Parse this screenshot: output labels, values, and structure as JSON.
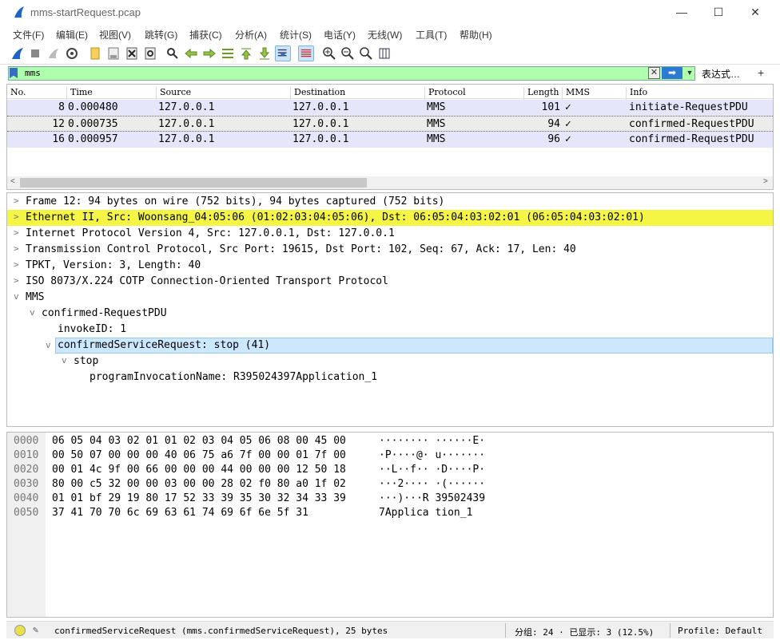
{
  "window": {
    "title": "mms-startRequest.pcap",
    "minimize": "—",
    "maximize": "☐",
    "close": "✕"
  },
  "menu": [
    "文件(F)",
    "编辑(E)",
    "视图(V)",
    "跳转(G)",
    "捕获(C)",
    "分析(A)",
    "统计(S)",
    "电话(Y)",
    "无线(W)",
    "工具(T)",
    "帮助(H)"
  ],
  "toolbar": {
    "icons": [
      "shark-fin-start-icon",
      "stop-capture-icon",
      "restart-capture-icon",
      "capture-options-icon",
      "open-file-icon",
      "save-file-icon",
      "close-file-icon",
      "reload-file-icon",
      "find-packet-icon",
      "go-back-icon",
      "go-forward-icon",
      "go-to-packet-icon",
      "first-packet-icon",
      "last-packet-icon",
      "autoscroll-icon",
      "colorize-icon",
      "zoom-in-icon",
      "zoom-out-icon",
      "normal-size-icon",
      "resize-columns-icon"
    ]
  },
  "filter": {
    "value": "mms",
    "clear": "✕",
    "apply": "➡",
    "dropdown": "▼",
    "expression": "表达式…",
    "add": "+"
  },
  "packet_list": {
    "columns": [
      "No.",
      "Time",
      "Source",
      "Destination",
      "Protocol",
      "Length",
      "MMS",
      "Info"
    ],
    "rows": [
      {
        "no": "8",
        "time": "0.000480",
        "src": "127.0.0.1",
        "dst": "127.0.0.1",
        "proto": "MMS",
        "len": "101",
        "mms": "✓",
        "info": "initiate-RequestPDU"
      },
      {
        "no": "12",
        "time": "0.000735",
        "src": "127.0.0.1",
        "dst": "127.0.0.1",
        "proto": "MMS",
        "len": "94",
        "mms": "✓",
        "info": "confirmed-RequestPDU"
      },
      {
        "no": "16",
        "time": "0.000957",
        "src": "127.0.0.1",
        "dst": "127.0.0.1",
        "proto": "MMS",
        "len": "96",
        "mms": "✓",
        "info": "confirmed-RequestPDU"
      }
    ]
  },
  "details": [
    {
      "twisty": ">",
      "text": "Frame 12: 94 bytes on wire (752 bits), 94 bytes captured (752 bits)"
    },
    {
      "twisty": ">",
      "text": "Ethernet II, Src: Woonsang_04:05:06 (01:02:03:04:05:06), Dst: 06:05:04:03:02:01 (06:05:04:03:02:01)"
    },
    {
      "twisty": ">",
      "text": "Internet Protocol Version 4, Src: 127.0.0.1, Dst: 127.0.0.1"
    },
    {
      "twisty": ">",
      "text": "Transmission Control Protocol, Src Port: 19615, Dst Port: 102, Seq: 67, Ack: 17, Len: 40"
    },
    {
      "twisty": ">",
      "text": "TPKT, Version: 3, Length: 40"
    },
    {
      "twisty": ">",
      "text": "ISO 8073/X.224 COTP Connection-Oriented Transport Protocol"
    },
    {
      "twisty": "v",
      "text": "MMS"
    },
    {
      "twisty": "v",
      "text": "confirmed-RequestPDU"
    },
    {
      "twisty": "",
      "text": "invokeID: 1"
    },
    {
      "twisty": "v",
      "text": "confirmedServiceRequest: stop (41)"
    },
    {
      "twisty": "v",
      "text": "stop"
    },
    {
      "twisty": "",
      "text": "programInvocationName: R395024397Application_1"
    }
  ],
  "bytes": [
    {
      "off": "0000",
      "hex": "06 05 04 03 02 01 01 02  03 04 05 06 08 00 45 00",
      "ascii": "········ ······E·"
    },
    {
      "off": "0010",
      "hex": "00 50 07 00 00 00 40 06  75 a6 7f 00 00 01 7f 00",
      "ascii": "·P····@· u·······"
    },
    {
      "off": "0020",
      "hex": "00 01 4c 9f 00 66 00 00  00 44 00 00 00 12 50 18",
      "ascii": "··L··f·· ·D····P·"
    },
    {
      "off": "0030",
      "hex": "80 00 c5 32 00 00 03 00  00 28 02 f0 80 a0 1f 02",
      "ascii": "···2···· ·(······"
    },
    {
      "off": "0040",
      "hex": "01 01 bf 29 19 80 17 52  33 39 35 30 32 34 33 39",
      "ascii": "···)···R 39502439"
    },
    {
      "off": "0050",
      "hex": "37 41 70 70 6c 69 63 61  74 69 6f 6e 5f 31",
      "ascii": "7Applica tion_1"
    }
  ],
  "status": {
    "field": "confirmedServiceRequest (mms.confirmedServiceRequest), 25 bytes",
    "packets": "分组: 24 · 已显示: 3 (12.5%)",
    "profile": "Profile: Default"
  }
}
